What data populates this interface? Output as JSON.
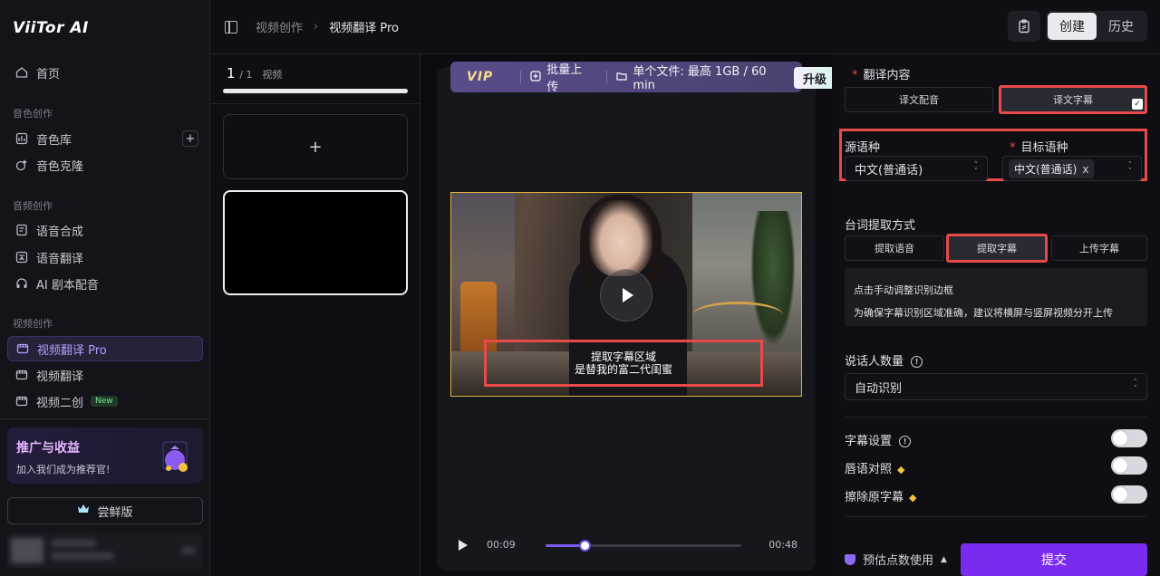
{
  "sidebar": {
    "logo": "ViiTor AI",
    "home": "首页",
    "sections": {
      "voice": "音色创作",
      "audio": "音频创作",
      "video": "视频创作"
    },
    "voice_items": [
      "音色库",
      "音色克隆"
    ],
    "audio_items": [
      "语音合成",
      "语音翻译",
      "AI 剧本配音"
    ],
    "video_items": [
      "视频翻译 Pro",
      "视频翻译",
      "视频二创"
    ],
    "new_badge": "New",
    "promo": {
      "title": "推广与收益",
      "subtitle": "加入我们成为推荐官!"
    },
    "trial_button": "尝鲜版"
  },
  "topbar": {
    "breadcrumb_parent": "视频创作",
    "breadcrumb_current": "视频翻译 Pro",
    "mode_create": "创建",
    "mode_history": "历史"
  },
  "video_list": {
    "current": "1",
    "total": "1",
    "label": "视频",
    "add_symbol": "+"
  },
  "preview": {
    "vip_label": "VIP",
    "batch_upload": "批量上传",
    "single_file_limit": "单个文件: 最高 1GB / 60 min",
    "upgrade": "升级",
    "subtitle_region_label": "提取字幕区域",
    "subtitle_text": "是替我的富二代闺蜜",
    "time_current": "00:09",
    "time_total": "00:48",
    "progress": 0.2
  },
  "settings": {
    "translate_content_label": "翻译内容",
    "content_options": [
      "译文配音",
      "译文字幕"
    ],
    "content_selected": 1,
    "source_lang_label": "源语种",
    "source_lang_value": "中文(普通话)",
    "target_lang_label": "目标语种",
    "target_lang_tag": "中文(普通话)",
    "tag_remove": "x",
    "extract_method_label": "台词提取方式",
    "extract_options": [
      "提取语音",
      "提取字幕",
      "上传字幕"
    ],
    "extract_selected": 1,
    "info_line1": "点击手动调整识别边框",
    "info_line2": "为确保字幕识别区域准确，建议将横屏与竖屏视频分开上传",
    "speaker_count_label": "说话人数量",
    "speaker_count_value": "自动识别",
    "subtitle_settings_label": "字幕设置",
    "lip_sync_label": "唇语对照",
    "erase_subtitle_label": "擦除原字幕",
    "toggles": {
      "subtitle_settings": true,
      "lip_sync": true,
      "erase_subtitle": true
    },
    "cost_label": "预估点数使用",
    "submit": "提交"
  },
  "colors": {
    "accent": "#7b2bf0",
    "highlight_red": "#e84a4a",
    "video_border": "#e3b23c"
  }
}
